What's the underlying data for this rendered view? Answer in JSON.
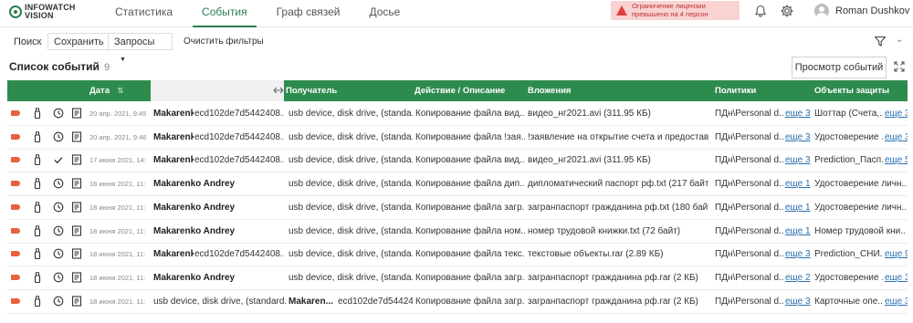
{
  "app": {
    "logo_line1": "INFOWATCH",
    "logo_line2": "VISION",
    "brand_color": "#2e8b4e"
  },
  "nav": {
    "tabs": [
      {
        "label": "Статистика"
      },
      {
        "label": "События",
        "active": true
      },
      {
        "label": "Граф связей"
      },
      {
        "label": "Досье"
      }
    ]
  },
  "alert": {
    "line1": "Ограничение лицензии",
    "line2": "превышено на 4 персон",
    "color": "#e04040"
  },
  "user": {
    "name": "Roman Dushkov"
  },
  "toolbar": {
    "search": "Поиск",
    "save": "Сохранить",
    "queries": "Запросы",
    "clear": "Очистить фильтры"
  },
  "list": {
    "title": "Список событий",
    "count": "9",
    "view_button": "Просмотр событий"
  },
  "columns": {
    "date": "Дата",
    "recipient": "Получатель",
    "action": "Действие / Описание",
    "attachments": "Вложения",
    "policies": "Политики",
    "objects": "Объекты защиты"
  },
  "rows": [
    {
      "status": "clock",
      "date": "20 апр. 2021, 9:45",
      "sender_name": "Makarenko...",
      "sender_id": "ecd102de7d5442408...",
      "recipient": "usb device, disk drive, (standa...",
      "action": "Копирование файла вид...",
      "attachment": "видео_нг2021.avi (311.95 КБ)",
      "policy": "ПДн\\Personal d...",
      "policy_more": "еще 3",
      "object": "Шоттар (Счета,...",
      "object_more": "еще 3"
    },
    {
      "status": "clock",
      "date": "20 апр. 2021, 9:46",
      "sender_name": "Makarenko...",
      "sender_id": "ecd102de7d5442408...",
      "recipient": "usb device, disk drive, (standa...",
      "action": "Копирование файла !зая...",
      "attachment": "!заявление на открытие счета и предостав...",
      "policy": "ПДн\\Personal d...",
      "policy_more": "еще 3",
      "object": "Удостоверение ...",
      "object_more": "еще 3"
    },
    {
      "status": "check",
      "date": "17 июня 2021, 14:",
      "sender_name": "Makarenko...",
      "sender_id": "ecd102de7d5442408...",
      "recipient": "usb device, disk drive, (standa...",
      "action": "Копирование файла вид...",
      "attachment": "видео_нг2021.avi (311.95 КБ)",
      "policy": "ПДн\\Personal d...",
      "policy_more": "еще 3",
      "object": "Prediction_Пасп...",
      "object_more": "еще 5"
    },
    {
      "status": "clock",
      "date": "18 июня 2021, 11:",
      "sender_name": "Makarenko Andrey",
      "sender_id": "",
      "recipient": "usb device, disk drive, (standa...",
      "action": "Копирование файла дип...",
      "attachment": "дипломатический паспорт рф.txt (217 байт)",
      "policy": "ПДн\\Personal d...",
      "policy_more": "еще 1",
      "object": "Удостоверение личн...",
      "object_more": ""
    },
    {
      "status": "clock",
      "date": "18 июня 2021, 11:",
      "sender_name": "Makarenko Andrey",
      "sender_id": "",
      "recipient": "usb device, disk drive, (standa...",
      "action": "Копирование файла загр...",
      "attachment": "загранпаспорт гражданина рф.txt (180 байт)",
      "policy": "ПДн\\Personal d...",
      "policy_more": "еще 1",
      "object": "Удостоверение личн...",
      "object_more": ""
    },
    {
      "status": "clock",
      "date": "18 июня 2021, 11:",
      "sender_name": "Makarenko Andrey",
      "sender_id": "",
      "recipient": "usb device, disk drive, (standa...",
      "action": "Копирование файла ном...",
      "attachment": "номер трудовой книжки.txt (72 байт)",
      "policy": "ПДн\\Personal d...",
      "policy_more": "еще 1",
      "object": "Номер трудовой кни...",
      "object_more": ""
    },
    {
      "status": "clock",
      "date": "18 июня 2021, 11:",
      "sender_name": "Makarenko...",
      "sender_id": "ecd102de7d5442408...",
      "recipient": "usb device, disk drive, (standa...",
      "action": "Копирование файла текс...",
      "attachment": "текстовые объекты.rar (2.89 КБ)",
      "policy": "ПДн\\Personal d...",
      "policy_more": "еще 3",
      "object": "Prediction_СНИ...",
      "object_more": "еще 9"
    },
    {
      "status": "clock",
      "date": "18 июня 2021, 11:",
      "sender_name": "Makarenko Andrey",
      "sender_id": "",
      "recipient": "usb device, disk drive, (standa...",
      "action": "Копирование файла загр...",
      "attachment": "загранпаспорт гражданина рф.rar (2 КБ)",
      "policy": "ПДн\\Personal d...",
      "policy_more": "еще 2",
      "object": "Удостоверение ...",
      "object_more": "еще 3"
    },
    {
      "status": "clock",
      "date": "18 июня 2021, 11:",
      "sender_name": "usb device, disk drive, (standard...",
      "sender_id": "",
      "recipient": "Makaren...",
      "recipient_id": "ecd102de7d544240...",
      "action": "Копирование файла загр...",
      "attachment": "загранпаспорт гражданина рф.rar (2 КБ)",
      "policy": "ПДн\\Personal d...",
      "policy_more": "еще 3",
      "object": "Карточные опе...",
      "object_more": "еще 3"
    }
  ]
}
